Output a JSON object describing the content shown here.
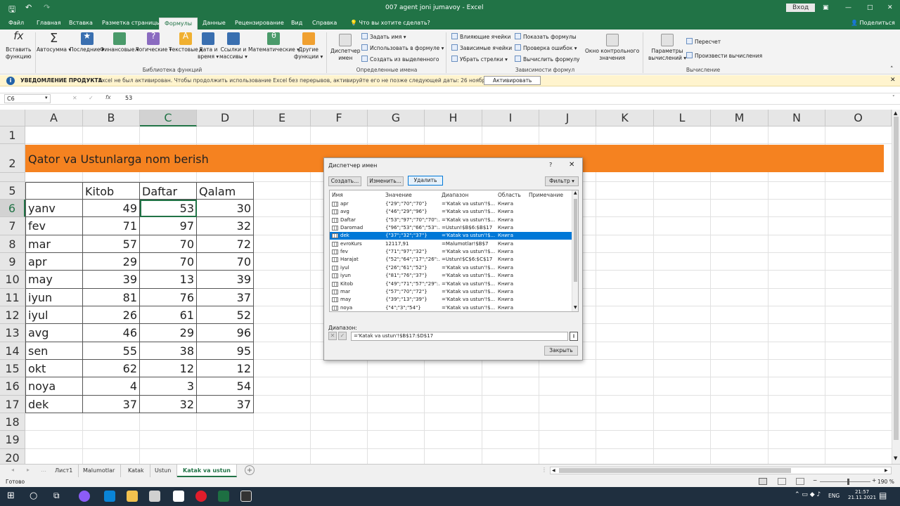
{
  "title_bar": {
    "document": "007 agent joni jumavoy",
    "app": "Excel",
    "signin": "Вход",
    "controls": [
      "—",
      "□",
      "✕"
    ]
  },
  "ribbon_tabs": [
    "Файл",
    "Главная",
    "Вставка",
    "Разметка страницы",
    "Формулы",
    "Данные",
    "Рецензирование",
    "Вид",
    "Справка"
  ],
  "tell_me": "Что вы хотите сделать?",
  "share": "Поделиться",
  "ribbon": {
    "insert_function": [
      "Вставить",
      "функцию"
    ],
    "library": [
      "Автосумма",
      "Последние",
      "Финансовые",
      "Логические",
      "Текстовые",
      "Дата и",
      "время",
      "Ссылки и",
      "массивы",
      "Математические",
      "Другие",
      "функции"
    ],
    "library_group": "Библиотека функций",
    "name_manager": [
      "Диспетчер",
      "имен"
    ],
    "defined_names": [
      "Задать имя",
      "Использовать в формуле",
      "Создать из выделенного"
    ],
    "defined_group": "Определенные имена",
    "audit": [
      "Влияющие ячейки",
      "Зависимые ячейки",
      "Убрать стрелки",
      "Показать формулы",
      "Проверка ошибок",
      "Вычислить формулу"
    ],
    "audit_group": "Зависимости формул",
    "watch": [
      "Окно контрольного",
      "значения"
    ],
    "calc_options": [
      "Параметры",
      "вычислений"
    ],
    "calc_now": "Пересчет",
    "calc_sheet": "Произвести вычисления",
    "calc_group": "Вычисление"
  },
  "notification": {
    "label": "УВЕДОМЛЕНИЕ ПРОДУКТА",
    "text": "Excel не был активирован. Чтобы продолжить использование Excel без перерывов, активируйте его не позже следующей даты: 26 ноября 2021 г...",
    "button": "Активировать"
  },
  "formula_bar": {
    "name_box": "C6",
    "fx": "fx",
    "value": "53"
  },
  "columns": [
    "A",
    "B",
    "C",
    "D",
    "E",
    "F",
    "G",
    "H",
    "I",
    "J",
    "K",
    "L",
    "M",
    "N",
    "O"
  ],
  "rows": [
    "1",
    "2",
    "5",
    "6",
    "7",
    "8",
    "9",
    "10",
    "11",
    "12",
    "13",
    "14",
    "15",
    "16",
    "17",
    "18",
    "19",
    "20"
  ],
  "banner_text": "Qator va Ustunlarga nom berish",
  "table": {
    "headers": [
      "Kitob",
      "Daftar",
      "Qalam"
    ],
    "data": [
      [
        "yanv",
        "49",
        "53",
        "30"
      ],
      [
        "fev",
        "71",
        "97",
        "32"
      ],
      [
        "mar",
        "57",
        "70",
        "72"
      ],
      [
        "apr",
        "29",
        "70",
        "70"
      ],
      [
        "may",
        "39",
        "13",
        "39"
      ],
      [
        "iyun",
        "81",
        "76",
        "37"
      ],
      [
        "iyul",
        "26",
        "61",
        "52"
      ],
      [
        "avg",
        "46",
        "29",
        "96"
      ],
      [
        "sen",
        "55",
        "38",
        "95"
      ],
      [
        "okt",
        "62",
        "12",
        "12"
      ],
      [
        "noya",
        "4",
        "3",
        "54"
      ],
      [
        "dek",
        "37",
        "32",
        "37"
      ]
    ]
  },
  "dialog": {
    "title": "Диспетчер имен",
    "help": "?",
    "close": "✕",
    "buttons": [
      "Создать...",
      "Изменить...",
      "Удалить"
    ],
    "filter": "Фильтр",
    "columns": [
      "Имя",
      "Значение",
      "Диапазон",
      "Область",
      "Примечание"
    ],
    "rows": [
      [
        "apr",
        "{\"29\";\"70\";\"70\"}",
        "='Katak va ustun'!$...",
        "Книга"
      ],
      [
        "avg",
        "{\"46\";\"29\";\"96\"}",
        "='Katak va ustun'!$...",
        "Книга"
      ],
      [
        "Daftar",
        "{\"53\";\"97\";\"70\";\"70\":...",
        "='Katak va ustun'!$...",
        "Книга"
      ],
      [
        "Daromad",
        "{\"96\";\"53\";\"66\";\"53\":...",
        "=Ustun!$B$6:$B$17",
        "Книга"
      ],
      [
        "dek",
        "{\"37\";\"32\";\"37\"}",
        "='Katak va ustun'!$...",
        "Книга"
      ],
      [
        "evroKurs",
        "12117,91",
        "=Malumotlar!$B$7",
        "Книга"
      ],
      [
        "fev",
        "{\"71\";\"97\";\"32\"}",
        "='Katak va ustun'!$...",
        "Книга"
      ],
      [
        "Harajat",
        "{\"52\";\"64\";\"17\";\"26\":...",
        "=Ustun!$C$6:$C$17",
        "Книга"
      ],
      [
        "iyul",
        "{\"26\";\"61\";\"52\"}",
        "='Katak va ustun'!$...",
        "Книга"
      ],
      [
        "iyun",
        "{\"81\";\"76\";\"37\"}",
        "='Katak va ustun'!$...",
        "Книга"
      ],
      [
        "Kitob",
        "{\"49\";\"71\";\"57\";\"29\":...",
        "='Katak va ustun'!$...",
        "Книга"
      ],
      [
        "mar",
        "{\"57\";\"70\";\"72\"}",
        "='Katak va ustun'!$...",
        "Книга"
      ],
      [
        "may",
        "{\"39\";\"13\";\"39\"}",
        "='Katak va ustun'!$...",
        "Книга"
      ],
      [
        "noya",
        "{\"4\";\"3\";\"54\"}",
        "='Katak va ustun'!$...",
        "Книга"
      ]
    ],
    "selected_index": 4,
    "range_label": "Диапазон:",
    "range_value": "='Katak va ustun'!$B$17:$D$17",
    "close_button": "Закрыть"
  },
  "sheet_tabs": [
    "Лист1",
    "Malumotlar",
    "Katak",
    "Ustun",
    "Katak va ustun"
  ],
  "active_tab": "Katak va ustun",
  "status": {
    "ready": "Готово",
    "zoom": "190 %"
  },
  "taskbar": {
    "lang": "ENG",
    "time": "21:57",
    "date": "21.11.2021"
  },
  "colors": {
    "excel_green": "#217346",
    "banner": "#f58220",
    "selection": "#0078d7"
  }
}
